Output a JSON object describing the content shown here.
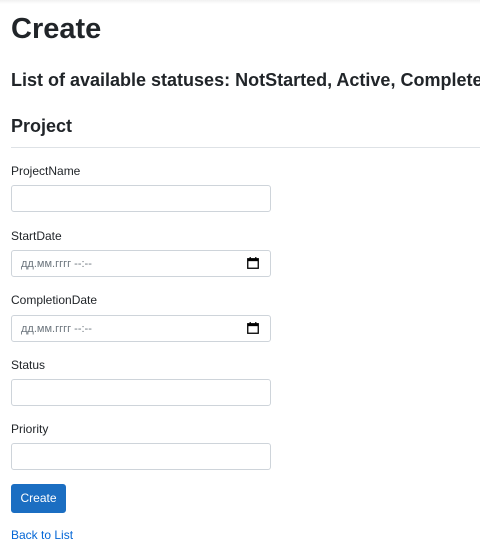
{
  "page": {
    "title": "Create",
    "statuses_heading": "List of available statuses: NotStarted, Active, Completed",
    "section_title": "Project"
  },
  "form": {
    "project_name": {
      "label": "ProjectName",
      "value": ""
    },
    "start_date": {
      "label": "StartDate",
      "placeholder": "дд.мм.гггг --:--"
    },
    "completion_date": {
      "label": "CompletionDate",
      "placeholder": "дд.мм.гггг --:--"
    },
    "status": {
      "label": "Status",
      "value": ""
    },
    "priority": {
      "label": "Priority",
      "value": ""
    },
    "submit_label": "Create"
  },
  "links": {
    "back_to_list": "Back to List"
  },
  "colors": {
    "primary_button": "#1b6ec2",
    "link": "#0366d6",
    "input_border": "#ced4da"
  }
}
